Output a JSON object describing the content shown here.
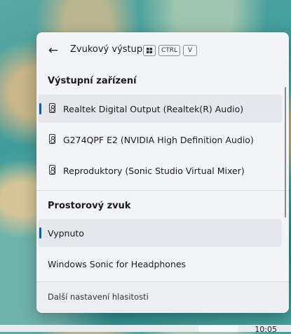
{
  "header": {
    "title": "Zvukový výstup",
    "shortcut_keys": [
      "CTRL",
      "V"
    ]
  },
  "output_devices": {
    "heading": "Výstupní zařízení",
    "items": [
      {
        "label": "Realtek Digital Output (Realtek(R) Audio)",
        "selected": true
      },
      {
        "label": "G274QPF E2 (NVIDIA High Definition Audio)",
        "selected": false
      },
      {
        "label": "Reproduktory (Sonic Studio Virtual Mixer)",
        "selected": false
      }
    ]
  },
  "spatial_sound": {
    "heading": "Prostorový zvuk",
    "items": [
      {
        "label": "Vypnuto",
        "selected": true
      },
      {
        "label": "Windows Sonic for Headphones",
        "selected": false
      }
    ]
  },
  "footer": {
    "link": "Další nastavení hlasitosti"
  },
  "taskbar": {
    "clock_partial": "10:05"
  },
  "colors": {
    "accent": "#005fb8",
    "panel_bg": "#f2f4f7",
    "selected_bg": "#e4e7eb"
  }
}
